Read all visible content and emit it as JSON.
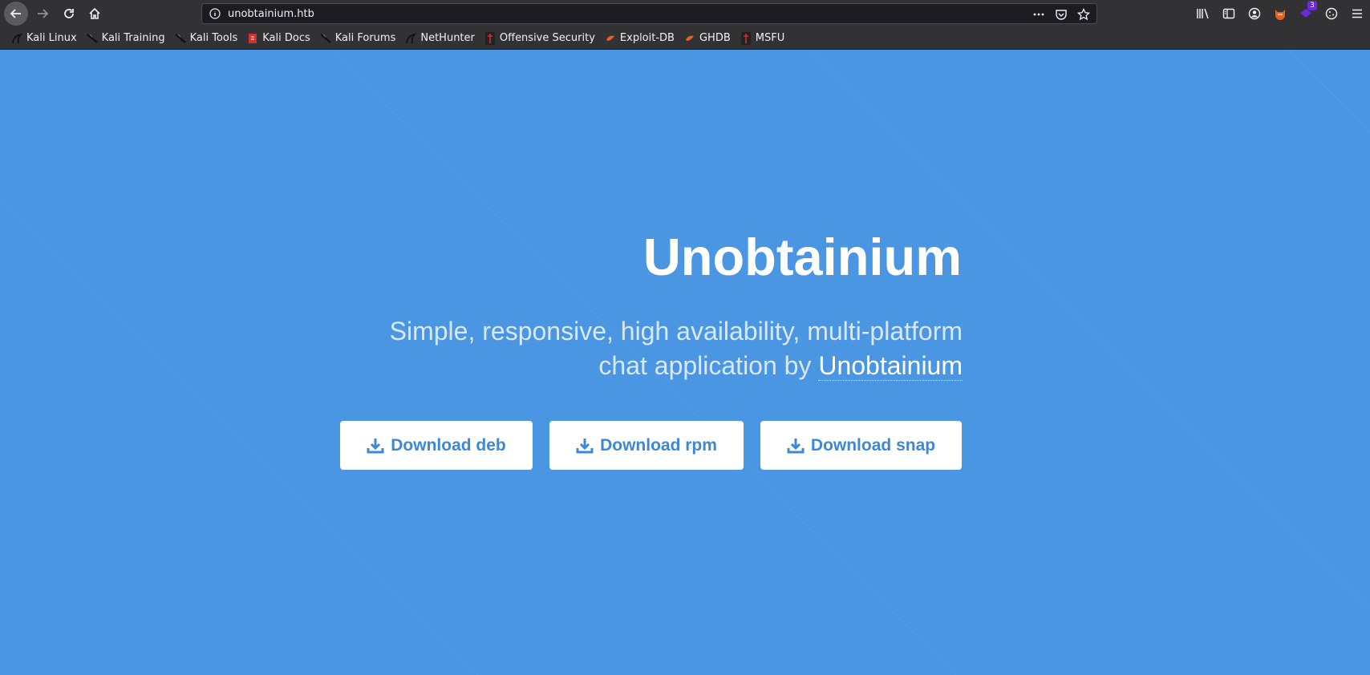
{
  "browser": {
    "url": "unobtainium.htb",
    "extension_badge": "3",
    "bookmarks": [
      {
        "label": "Kali Linux"
      },
      {
        "label": "Kali Training"
      },
      {
        "label": "Kali Tools"
      },
      {
        "label": "Kali Docs"
      },
      {
        "label": "Kali Forums"
      },
      {
        "label": "NetHunter"
      },
      {
        "label": "Offensive Security"
      },
      {
        "label": "Exploit-DB"
      },
      {
        "label": "GHDB"
      },
      {
        "label": "MSFU"
      }
    ]
  },
  "hero": {
    "title": "Unobtainium",
    "subtitle_line1": "Simple, responsive, high availability, multi-platform",
    "subtitle_line2_prefix": "chat application by",
    "subtitle_link": "Unobtainium"
  },
  "buttons": {
    "deb": "Download deb",
    "rpm": "Download rpm",
    "snap": "Download snap"
  },
  "colors": {
    "page_background": "#4a96e3",
    "button_text": "#3d87d8",
    "browser_chrome": "#323234"
  }
}
